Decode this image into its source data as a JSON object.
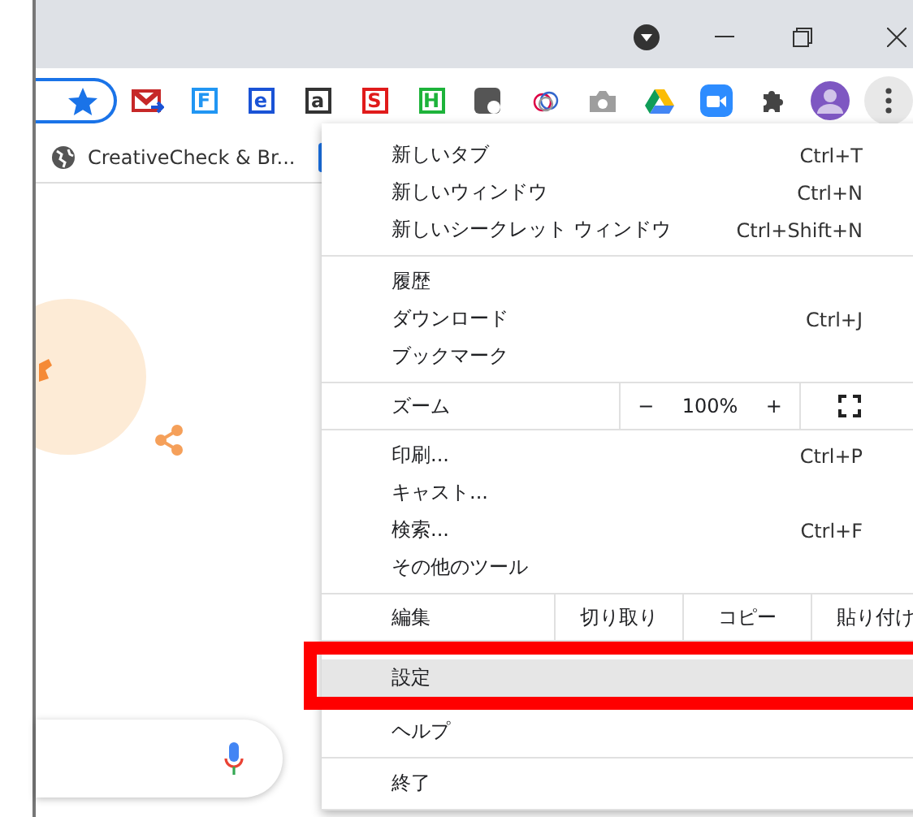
{
  "toolbar": {
    "extensions": [
      {
        "kind": "mail"
      },
      {
        "kind": "letter",
        "text": "F",
        "color": "#2196f3"
      },
      {
        "kind": "letter",
        "text": "e",
        "color": "#1a53d6"
      },
      {
        "kind": "letter",
        "text": "a",
        "color": "#333333"
      },
      {
        "kind": "letter",
        "text": "S",
        "color": "#e01b1b"
      },
      {
        "kind": "letter",
        "text": "H",
        "color": "#1db33a"
      },
      {
        "kind": "dark"
      },
      {
        "kind": "rings"
      },
      {
        "kind": "camera"
      },
      {
        "kind": "drive"
      },
      {
        "kind": "video"
      },
      {
        "kind": "puzzle"
      },
      {
        "kind": "avatar"
      }
    ]
  },
  "bookmarks": [
    {
      "label": "CreativeCheck & Br..."
    }
  ],
  "menu": {
    "sections": [
      {
        "items": [
          {
            "kind": "item",
            "label": "新しいタブ",
            "shortcut": "Ctrl+T",
            "selected": false
          },
          {
            "kind": "item",
            "label": "新しいウィンドウ",
            "shortcut": "Ctrl+N",
            "selected": false
          },
          {
            "kind": "item",
            "label": "新しいシークレット ウィンドウ",
            "shortcut": "Ctrl+Shift+N",
            "selected": false
          }
        ]
      },
      {
        "items": [
          {
            "kind": "item",
            "label": "履歴",
            "selected": false
          },
          {
            "kind": "item",
            "label": "ダウンロード",
            "shortcut": "Ctrl+J",
            "selected": false
          },
          {
            "kind": "item",
            "label": "ブックマーク",
            "selected": false
          }
        ]
      },
      {
        "items": [
          {
            "kind": "zoom",
            "label": "ズーム",
            "minus": "−",
            "value": "100%",
            "plus": "+"
          }
        ]
      },
      {
        "items": [
          {
            "kind": "item",
            "label": "印刷...",
            "shortcut": "Ctrl+P",
            "selected": false
          },
          {
            "kind": "item",
            "label": "キャスト...",
            "selected": false
          },
          {
            "kind": "item",
            "label": "検索...",
            "shortcut": "Ctrl+F",
            "selected": false
          },
          {
            "kind": "item",
            "label": "その他のツール",
            "selected": false
          }
        ]
      },
      {
        "items": [
          {
            "kind": "edit",
            "label": "編集",
            "actions": [
              "切り取り",
              "コピー",
              "貼り付け"
            ]
          }
        ]
      },
      {
        "items": [
          {
            "kind": "item",
            "label": "設定",
            "selected": true
          },
          {
            "kind": "item",
            "label": "ヘルプ",
            "selected": false
          }
        ]
      },
      {
        "items": [
          {
            "kind": "item",
            "label": "終了",
            "selected": false
          }
        ]
      }
    ]
  }
}
